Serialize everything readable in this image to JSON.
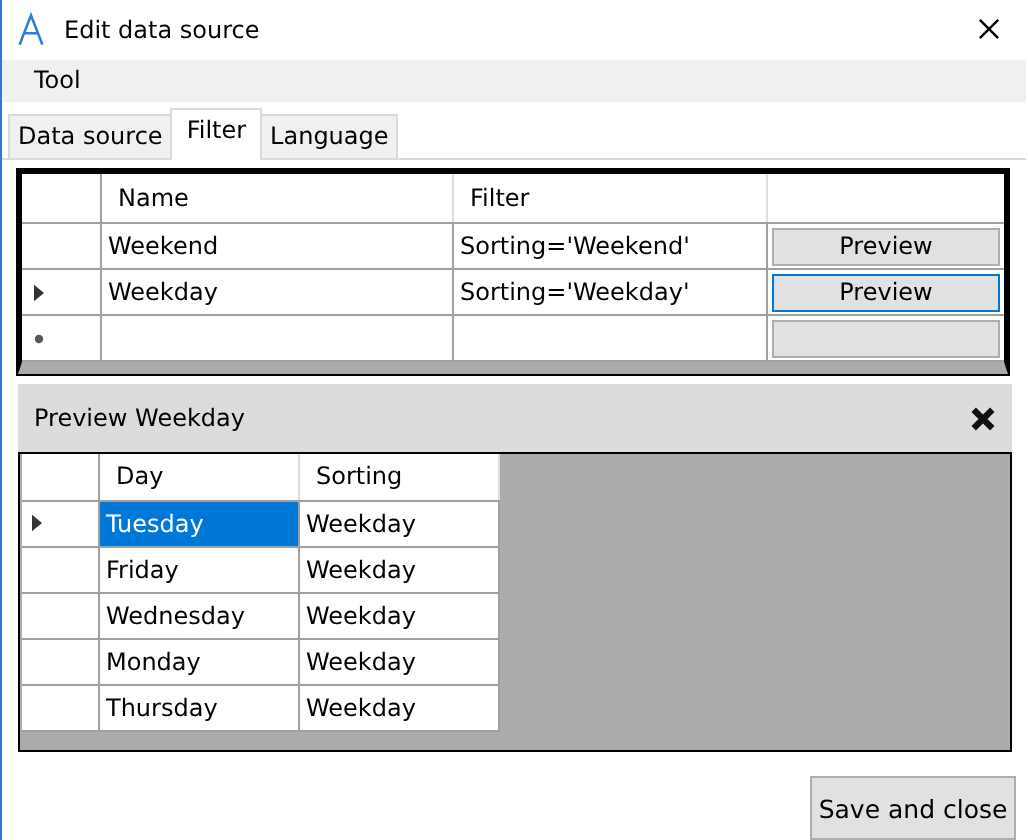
{
  "window": {
    "title": "Edit data source"
  },
  "menu": [
    "Tool"
  ],
  "tabs": [
    {
      "label": "Data source",
      "selected": false
    },
    {
      "label": "Filter",
      "selected": true
    },
    {
      "label": "Language",
      "selected": false
    }
  ],
  "filters": {
    "columns": [
      "Name",
      "Filter"
    ],
    "rows": [
      {
        "kind": "row",
        "name": "Weekend",
        "filter": "Sorting='Weekend'",
        "button": "Preview",
        "current": false,
        "focused": false
      },
      {
        "kind": "row",
        "name": "Weekday",
        "filter": "Sorting='Weekday'",
        "button": "Preview",
        "current": true,
        "focused": true
      },
      {
        "kind": "new"
      }
    ]
  },
  "preview": {
    "title": "Preview Weekday",
    "columns": [
      "Day",
      "Sorting"
    ],
    "rows": [
      {
        "day": "Tuesday",
        "sorting": "Weekday",
        "current": true,
        "selected": true
      },
      {
        "day": "Friday",
        "sorting": "Weekday",
        "current": false,
        "selected": false
      },
      {
        "day": "Wednesday",
        "sorting": "Weekday",
        "current": false,
        "selected": false
      },
      {
        "day": "Monday",
        "sorting": "Weekday",
        "current": false,
        "selected": false
      },
      {
        "day": "Thursday",
        "sorting": "Weekday",
        "current": false,
        "selected": false
      }
    ]
  },
  "save_button": "Save and close"
}
